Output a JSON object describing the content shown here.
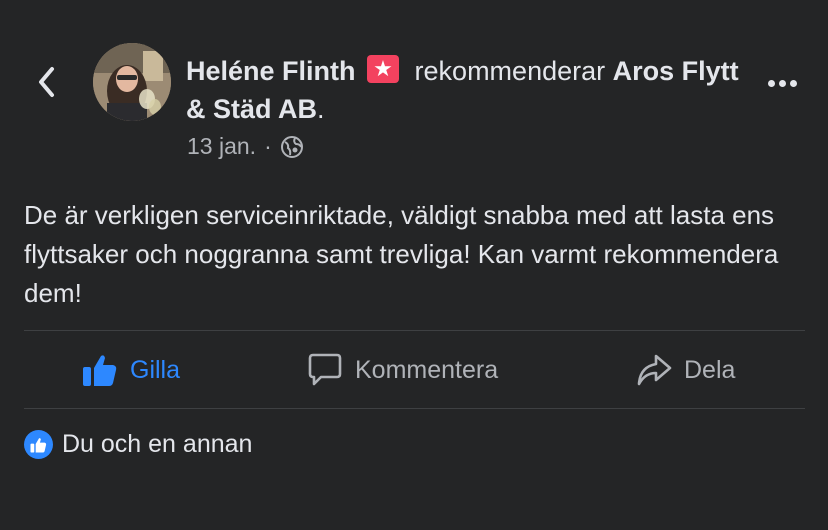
{
  "header": {
    "author": "Heléne Flinth",
    "verb": "rekommenderar",
    "page": "Aros Flytt & Städ AB",
    "period": ".",
    "date": "13 jan.",
    "separator": "·"
  },
  "icons": {
    "back": "chevron-left-icon",
    "badge": "recommend-star-icon",
    "privacy": "globe-icon",
    "more": "more-dots-icon",
    "like": "thumbs-up-icon",
    "comment": "comment-bubble-icon",
    "share": "share-arrow-icon"
  },
  "post": {
    "text": "De är verkligen serviceinriktade, väldigt snabba med att lasta ens flyttsaker och noggranna samt trevliga! Kan varmt rekommendera dem!"
  },
  "actions": {
    "like": "Gilla",
    "comment": "Kommentera",
    "share": "Dela"
  },
  "reactions": {
    "summary": "Du och en annan"
  },
  "colors": {
    "background": "#242526",
    "text": "#e4e6eb",
    "muted": "#b0b3b8",
    "accent_blue": "#2d88ff",
    "badge_pink": "#f3425f"
  }
}
